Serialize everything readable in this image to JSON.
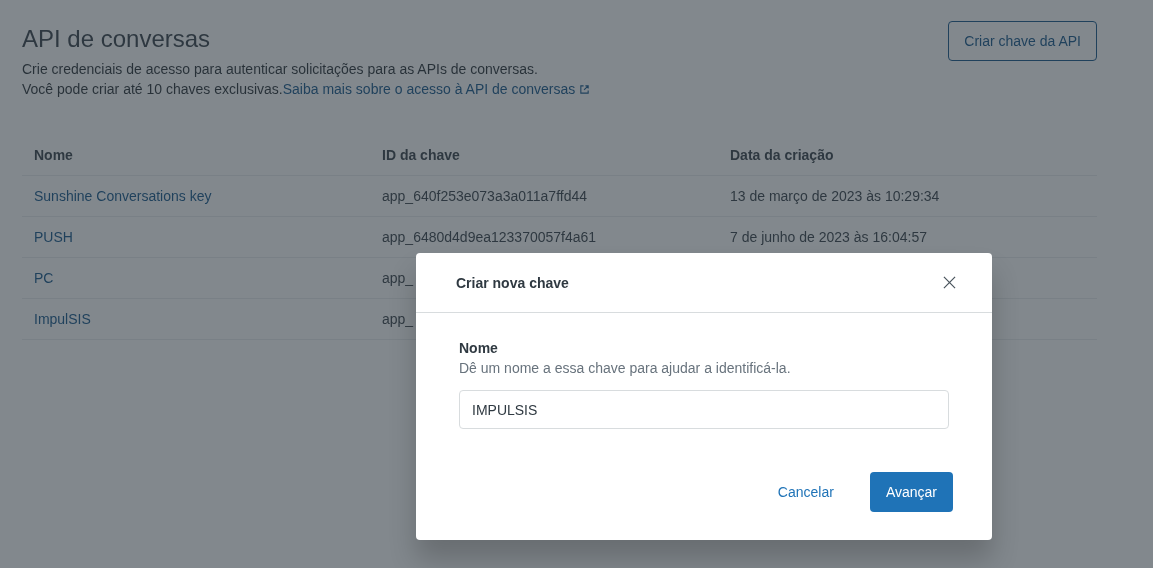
{
  "page": {
    "title": "API de conversas",
    "description": "Crie credenciais de acesso para autenticar solicitações para as APIs de conversas.",
    "note": "Você pode criar até 10 chaves exclusivas.",
    "link": "Saiba mais sobre o acesso à API de conversas",
    "create_button": "Criar chave da API"
  },
  "table": {
    "columns": [
      "Nome",
      "ID da chave",
      "Data da criação"
    ],
    "rows": [
      {
        "name": "Sunshine Conversations key",
        "key_id": "app_640f253e073a3a011a7ffd44",
        "created": "13 de março de 2023 às 10:29:34"
      },
      {
        "name": "PUSH",
        "key_id": "app_6480d4d9ea123370057f4a61",
        "created": "7 de junho de 2023 às 16:04:57"
      },
      {
        "name": "PC",
        "key_id": "app_"
      },
      {
        "name": "ImpulSIS",
        "key_id": "app_"
      }
    ]
  },
  "modal": {
    "title": "Criar nova chave",
    "field_label": "Nome",
    "field_hint": "Dê um nome a essa chave para ajudar a identificá-la.",
    "field_value": "IMPULSIS",
    "cancel": "Cancelar",
    "submit": "Avançar"
  }
}
